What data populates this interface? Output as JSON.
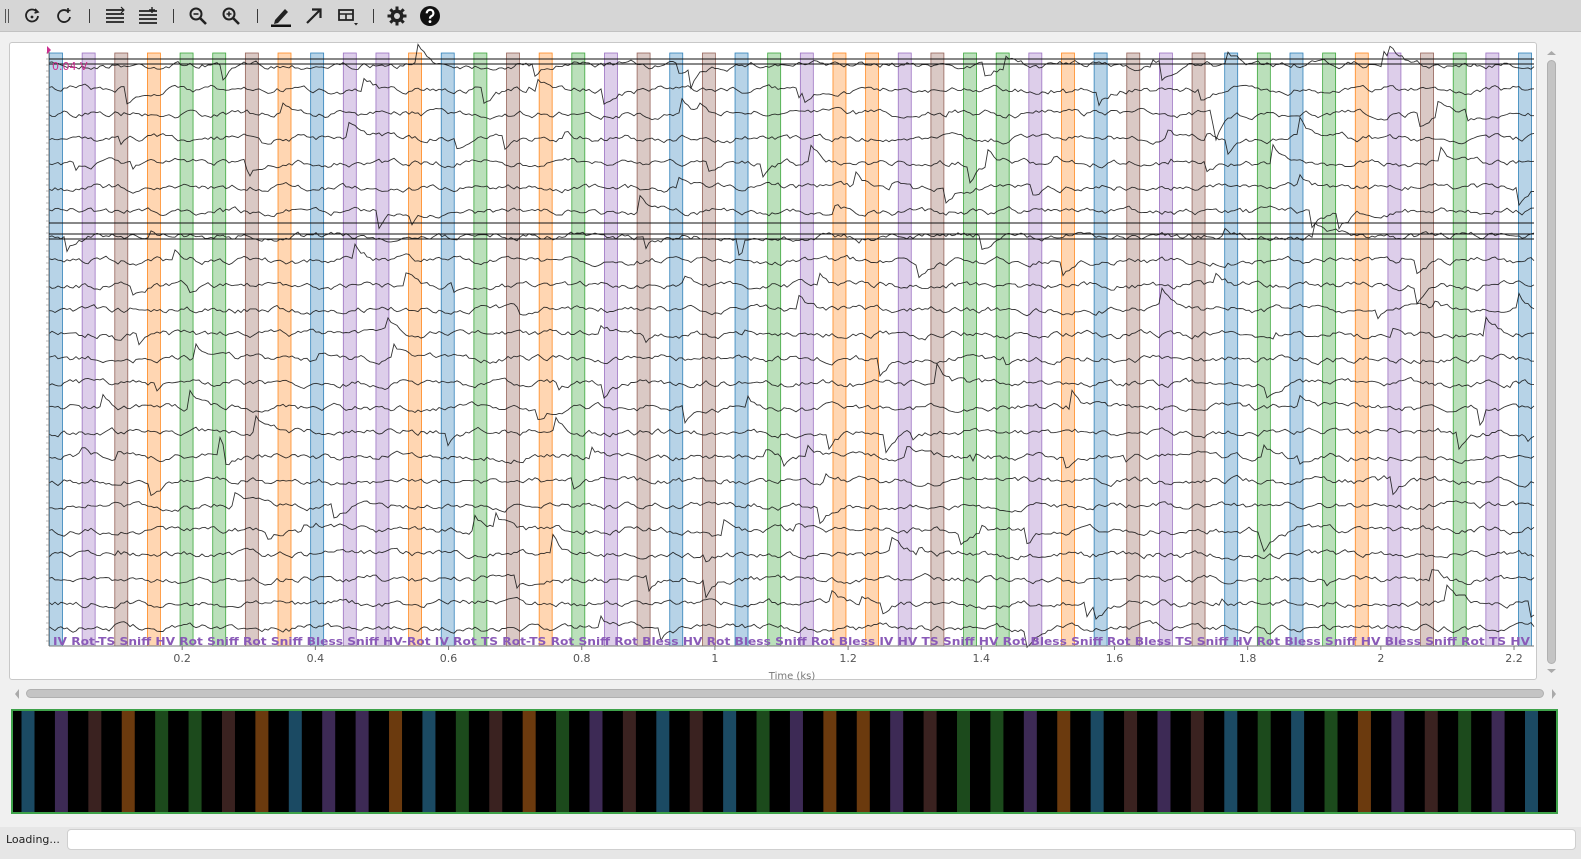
{
  "toolbar": {
    "tools": [
      {
        "name": "reset-view-icon"
      },
      {
        "name": "undo-rotate-icon"
      },
      {
        "name": "redo-rotate-icon"
      },
      {
        "name": "decrease-spacing-icon"
      },
      {
        "name": "increase-spacing-icon"
      },
      {
        "name": "zoom-out-icon"
      },
      {
        "name": "zoom-in-icon"
      },
      {
        "name": "annotate-pen-icon"
      },
      {
        "name": "arrow-icon"
      },
      {
        "name": "layout-menu-icon"
      },
      {
        "name": "settings-gear-icon"
      },
      {
        "name": "help-icon"
      }
    ]
  },
  "plot": {
    "scale_label": "0.04 V",
    "xlabel": "Time (ks)",
    "x_ticks": [
      "0.2",
      "0.4",
      "0.6",
      "0.8",
      "1",
      "1.2",
      "1.4",
      "1.6",
      "1.8",
      "2",
      "2.2"
    ],
    "x_range": [
      0.0,
      2.23
    ],
    "channel_count": 24,
    "event_colors": {
      "blue": "#1f77b4",
      "purple": "#9467bd",
      "brown": "#8c564b",
      "orange": "#ff7f0e",
      "green": "#2ca02c"
    },
    "label_strip": "IV Rot-TS Sniff HV Rot Sniff Rot Sniff Bless Sniff HV-Rot IV Rot TS Rot-TS Rot Sniff Rot Bless HV Rot Bless Sniff Rot Bless IV HV TS Sniff HV Rot Bless Sniff Rot Bless TS Sniff HV Rot Bless Sniff HV Bless Sniff Rot TS HV"
  },
  "status": {
    "text": "Loading..."
  }
}
